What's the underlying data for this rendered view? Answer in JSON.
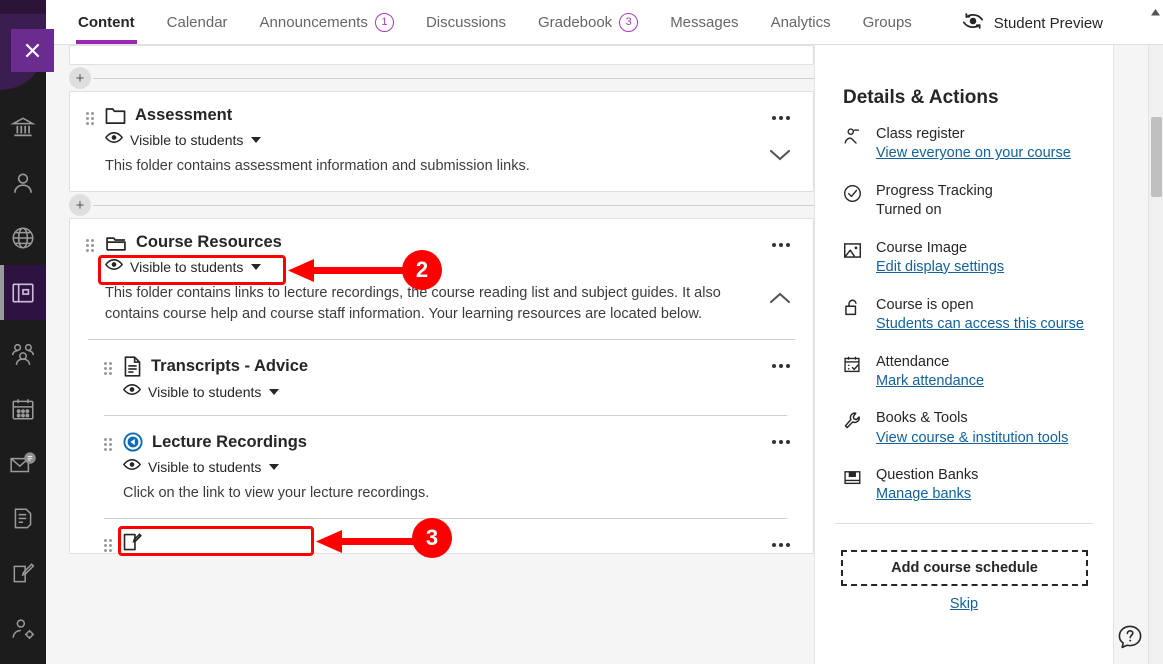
{
  "app": {
    "close_label": "Close",
    "accent_purple": "#9c27b0",
    "annotation_red": "#ff0000",
    "link_blue": "#14619b"
  },
  "rail": {
    "items": [
      {
        "name": "institution-icon",
        "label": "Institution Page",
        "active": false
      },
      {
        "name": "profile-icon",
        "label": "Profile",
        "active": false
      },
      {
        "name": "globe-icon",
        "label": "Activity Stream",
        "active": false
      },
      {
        "name": "courses-icon",
        "label": "Courses",
        "active": true
      },
      {
        "name": "groups-icon",
        "label": "Organisations",
        "active": false
      },
      {
        "name": "calendar-icon",
        "label": "Calendar",
        "active": false
      },
      {
        "name": "messages-icon",
        "label": "Messages",
        "active": false
      },
      {
        "name": "gradebook-icon",
        "label": "Marks",
        "active": false
      },
      {
        "name": "tools-icon",
        "label": "Tools",
        "active": false
      },
      {
        "name": "admin-icon",
        "label": "Admin",
        "active": false
      }
    ]
  },
  "topnav": {
    "tabs": [
      {
        "label": "Content",
        "badge": null,
        "active": true
      },
      {
        "label": "Calendar",
        "badge": null,
        "active": false
      },
      {
        "label": "Announcements",
        "badge": "1",
        "active": false
      },
      {
        "label": "Discussions",
        "badge": null,
        "active": false
      },
      {
        "label": "Gradebook",
        "badge": "3",
        "active": false
      },
      {
        "label": "Messages",
        "badge": null,
        "active": false
      },
      {
        "label": "Analytics",
        "badge": null,
        "active": false
      },
      {
        "label": "Groups",
        "badge": null,
        "active": false
      }
    ],
    "student_preview": "Student Preview"
  },
  "content": {
    "visible_label": "Visible to students",
    "assessment": {
      "title": "Assessment",
      "icon": "folder-icon",
      "visibility": "Visible to students",
      "description": "This folder contains assessment information and submission links.",
      "expanded": false
    },
    "course_resources": {
      "title": "Course Resources",
      "icon": "open-folder-icon",
      "visibility": "Visible to students",
      "description": "This folder contains links to lecture recordings, the course reading list and subject guides. It also contains course help and course staff information. Your learning resources are located below.",
      "expanded": true
    },
    "children": [
      {
        "title": "Transcripts - Advice",
        "icon": "document-icon",
        "visibility": "Visible to students",
        "description": ""
      },
      {
        "title": "Lecture Recordings",
        "icon": "link-tool-icon",
        "visibility": "Visible to students",
        "description": "Click on the link to view your lecture recordings."
      }
    ]
  },
  "sidebar": {
    "title": "Details & Actions",
    "items": [
      {
        "icon": "class-register-icon",
        "label": "Class register",
        "link": "View everyone on your course",
        "value": null
      },
      {
        "icon": "progress-check-icon",
        "label": "Progress Tracking",
        "link": null,
        "value": "Turned on"
      },
      {
        "icon": "course-image-icon",
        "label": "Course Image",
        "link": "Edit display settings",
        "value": null
      },
      {
        "icon": "unlock-icon",
        "label": "Course is open",
        "link": "Students can access this course",
        "value": null
      },
      {
        "icon": "attendance-calendar-icon",
        "label": "Attendance",
        "link": "Mark attendance",
        "value": null
      },
      {
        "icon": "wrench-icon",
        "label": "Books & Tools",
        "link": "View course & institution tools",
        "value": null
      },
      {
        "icon": "question-bank-icon",
        "label": "Question Banks",
        "link": "Manage banks",
        "value": null
      }
    ],
    "add_schedule_label": "Add course schedule",
    "skip_label": "Skip"
  },
  "annotations": [
    {
      "number": "2",
      "target": "Course Resources"
    },
    {
      "number": "3",
      "target": "Lecture Recordings"
    }
  ]
}
